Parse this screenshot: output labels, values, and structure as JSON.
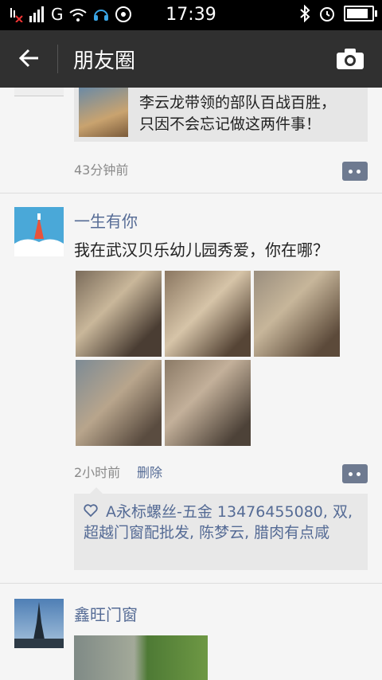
{
  "status_bar": {
    "time": "17:39",
    "battery_level": 0.85,
    "left_icons": [
      "signal-x-icon",
      "signal-bars-icon",
      "g-network-icon",
      "wifi-icon",
      "headset-icon",
      "media-icon"
    ],
    "right_icons": [
      "bluetooth-icon",
      "alarm-icon",
      "battery-icon"
    ],
    "network_label": "G"
  },
  "header": {
    "title": "朋友圈",
    "back_icon": "arrow-left-icon",
    "camera_icon": "camera-icon"
  },
  "posts": [
    {
      "share_text_line1": "李云龙带领的部队百战百胜，",
      "share_text_line2": "只因不会忘记做这两件事！",
      "time": "43分钟前"
    },
    {
      "name": "一生有你",
      "text": "我在武汉贝乐幼儿园秀爱，你在哪？",
      "photo_count": 5,
      "time": "2小时前",
      "delete_label": "删除",
      "likes": "A永标螺丝-五金 13476455080, 双, 超越门窗配批发, 陈梦云, 腊肉有点咸"
    },
    {
      "name": "鑫旺门窗"
    }
  ],
  "colors": {
    "accent_name": "#556b95",
    "header_bg": "#303030",
    "status_bg": "#000000"
  }
}
